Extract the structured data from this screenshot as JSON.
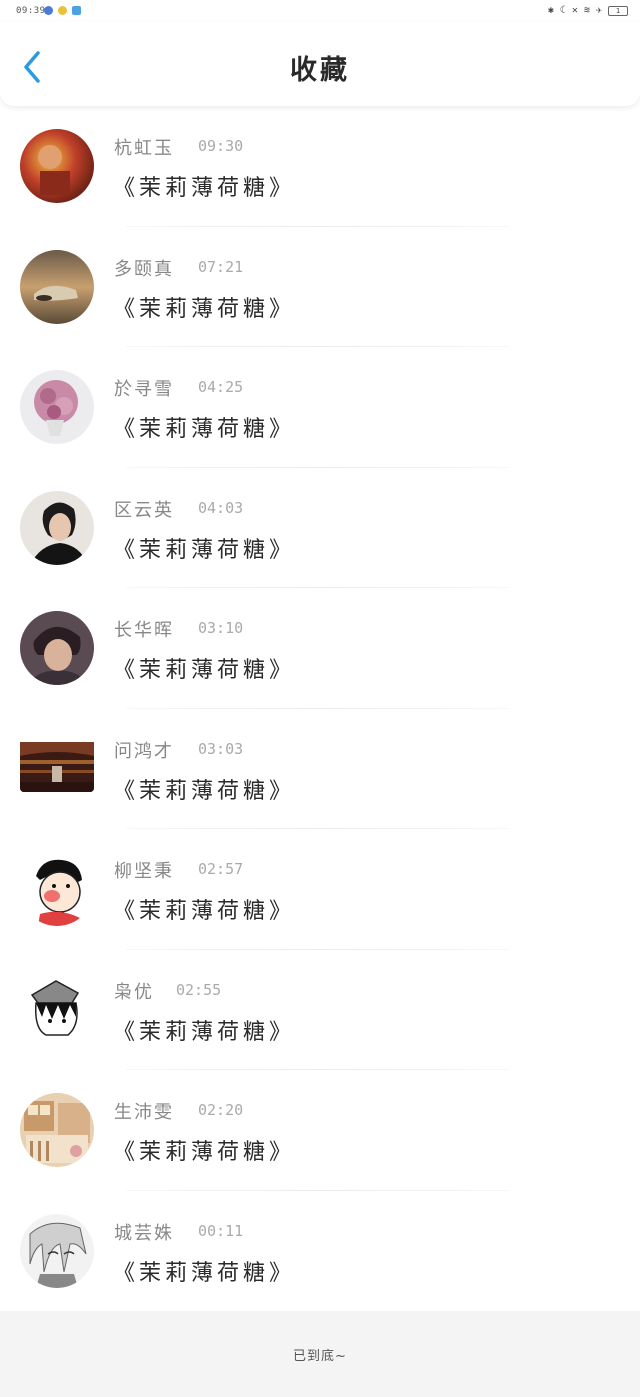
{
  "status_bar": {
    "time": "09:39",
    "battery": "1"
  },
  "header": {
    "title": "收藏"
  },
  "items": [
    {
      "name": "杭虹玉",
      "time": "09:30",
      "song": "《茉莉薄荷糖》",
      "avatar": "avatar-1"
    },
    {
      "name": "多颐真",
      "time": "07:21",
      "song": "《茉莉薄荷糖》",
      "avatar": "avatar-2"
    },
    {
      "name": "於寻雪",
      "time": "04:25",
      "song": "《茉莉薄荷糖》",
      "avatar": "avatar-3"
    },
    {
      "name": "区云英",
      "time": "04:03",
      "song": "《茉莉薄荷糖》",
      "avatar": "avatar-4"
    },
    {
      "name": "长华晖",
      "time": "03:10",
      "song": "《茉莉薄荷糖》",
      "avatar": "avatar-5"
    },
    {
      "name": "问鸿才",
      "time": "03:03",
      "song": "《茉莉薄荷糖》",
      "avatar": "avatar-6"
    },
    {
      "name": "柳坚秉",
      "time": "02:57",
      "song": "《茉莉薄荷糖》",
      "avatar": "avatar-7"
    },
    {
      "name": "枭优",
      "time": "02:55",
      "song": "《茉莉薄荷糖》",
      "avatar": "avatar-8"
    },
    {
      "name": "生沛雯",
      "time": "02:20",
      "song": "《茉莉薄荷糖》",
      "avatar": "avatar-9"
    },
    {
      "name": "城芸姝",
      "time": "00:11",
      "song": "《茉莉薄荷糖》",
      "avatar": "avatar-10"
    }
  ],
  "footer": {
    "text": "已到底~"
  },
  "colors": {
    "accent": "#2b9be0",
    "title": "#2a2a2a",
    "username": "#888888",
    "time": "#aaaaaa"
  }
}
